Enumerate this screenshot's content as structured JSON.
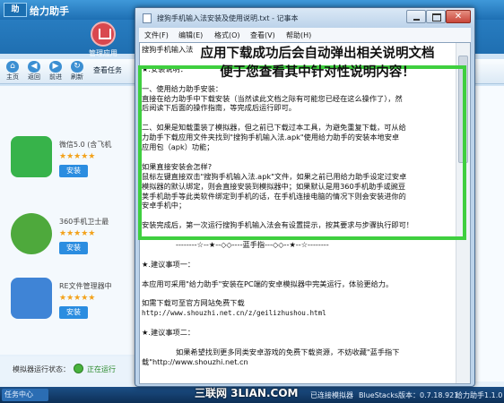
{
  "app": {
    "logo_text": "助",
    "title": "给力助手",
    "top_nav": [
      {
        "label": "管理应用"
      }
    ],
    "toolbar": [
      {
        "label": "主页",
        "icon": "home-icon",
        "glyph": "⌂"
      },
      {
        "label": "返回",
        "icon": "back-icon",
        "glyph": "◀"
      },
      {
        "label": "前进",
        "icon": "forward-icon",
        "glyph": "▶"
      },
      {
        "label": "刷新",
        "icon": "refresh-icon",
        "glyph": "↻"
      }
    ],
    "task_button": "查看任务",
    "apps": [
      {
        "name": "微信5.0 (含飞机",
        "stars": "★★★★★",
        "install": "安装",
        "icon": "wechat-icon",
        "color": "#37b34a"
      },
      {
        "name": "360手机卫士最",
        "stars": "★★★★★",
        "install": "安装",
        "icon": "360-security-icon",
        "color": "#4ea93c"
      },
      {
        "name": "RE文件管理器中",
        "stars": "★★★★★",
        "install": "安装",
        "icon": "re-file-manager-icon",
        "color": "#3f84d6"
      }
    ],
    "status": {
      "label": "模拟器运行状态：",
      "value": "正在运行"
    }
  },
  "taskbar": {
    "task_center": "任务中心",
    "items": [
      "已连接模拟器",
      "BlueStacks版本：0.7.18.921",
      "给力助手1.1.0"
    ]
  },
  "watermark": "三联网 3LIAN.COM",
  "notepad": {
    "title": "搜狗手机输入法安装及使用说明.txt - 记事本",
    "menus": [
      "文件(F)",
      "编辑(E)",
      "格式(O)",
      "查看(V)",
      "帮助(H)"
    ],
    "lines": [
      "搜狗手机输入法",
      "",
      "★.安装说明：",
      "",
      "一、使用给力助手安装：",
      "直接在给力助手中下载安装（当然读此文档之际有可能您已经在这么操作了），然",
      "后阅读下后面的操作指南，等完成后运行即可。",
      "",
      "二、如果是知载重装了模拟器，但之前已下载过本工具，为避免重复下载，可从给",
      "力助手下载应用文件夹找到\"搜狗手机输入法.apk\"使用给力助手的安装本地安卓",
      "应用包（apk）功能；",
      "",
      "如果直接安装会怎样?",
      "鼠标左键直接双击\"搜狗手机输入法.apk\"文件，如果之前已用给力助手设定过安卓",
      "模拟器的默认绑定，则会直接安装到模拟器中；如果默认是用360手机助手或豌豆",
      "荚手机助手等此类软件绑定到手机的话，在手机连接电脑的情况下则会安装进你的",
      "安卓手机中；",
      "",
      "安装完成后，第一次运行搜狗手机输入法会有设置提示，按其要求与步骤执行即可！",
      "",
      "--------☆--★--◇◇----蓝手指---◇◇--★--☆--------",
      "",
      "★.建议事项一：",
      "",
      "本应用可采用\"给力助手\"安装在PC端的安卓模拟器中完美运行，体验更给力。",
      "",
      "如需下载可至官方网站免费下载",
      "http://www.shouzhi.net.cn/z/geilizhushou.html",
      "",
      "★.建议事项二：",
      "",
      "如果希望找到更多同类安卓游戏的免费下载资源，不妨收藏\"蓝手指下",
      "载\"http://www.shouzhi.net.cn"
    ]
  },
  "annotation": {
    "line1": "应用下载成功后会自动弹出相关说明文档",
    "line2": "便于您查看其中针对性说明内容！",
    "box_color": "#3fcf3f"
  }
}
